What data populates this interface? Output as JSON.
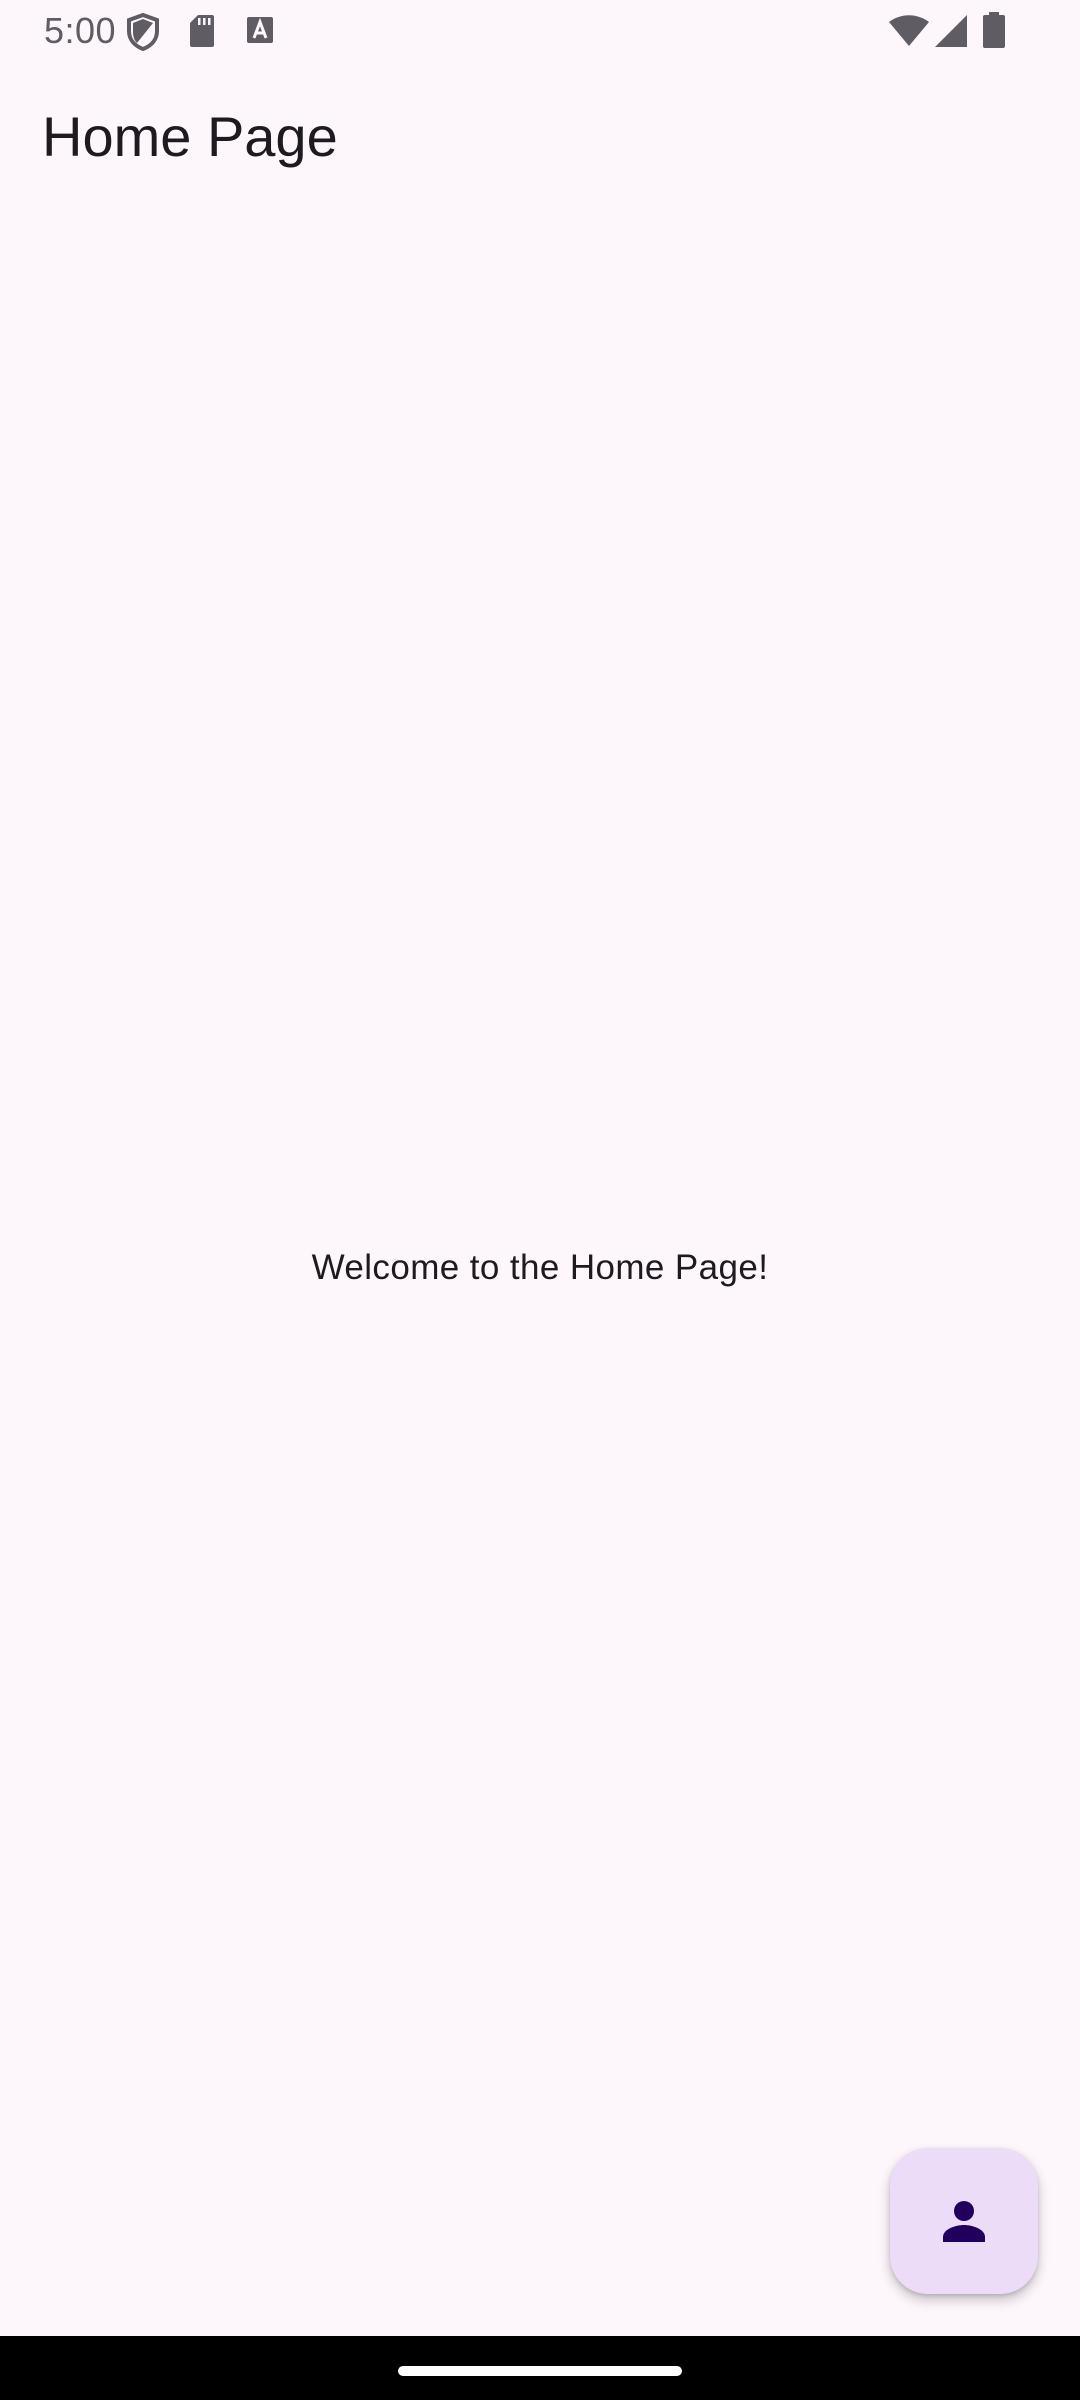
{
  "status_bar": {
    "time": "5:00",
    "left_icons": [
      "shield-icon",
      "sd-card-icon",
      "keyboard-a-icon"
    ],
    "right_icons": [
      "wifi-icon",
      "cell-signal-icon",
      "battery-icon"
    ]
  },
  "app_bar": {
    "title": "Home Page"
  },
  "main": {
    "welcome_text": "Welcome to the Home Page!"
  },
  "fab": {
    "icon": "person-icon"
  },
  "colors": {
    "background": "#fdf7fc",
    "fab_background": "#ecdcf8",
    "fab_icon": "#21005d",
    "text": "#1d1b20"
  }
}
